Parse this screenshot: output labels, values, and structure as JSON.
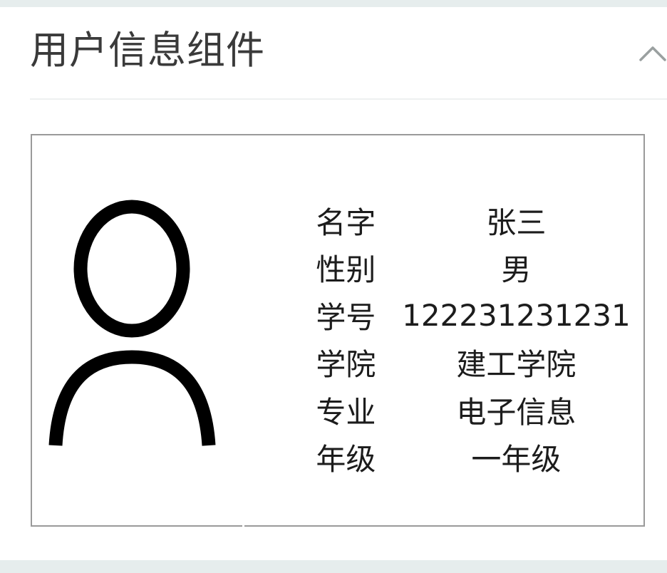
{
  "header": {
    "title": "用户信息组件",
    "collapse_icon": "chevron-up-icon"
  },
  "card": {
    "avatar_icon": "user-avatar-icon",
    "rows": [
      {
        "label": "名字",
        "value": "张三"
      },
      {
        "label": "性别",
        "value": "男"
      },
      {
        "label": "学号",
        "value": "122231231231"
      },
      {
        "label": "学院",
        "value": "建工学院"
      },
      {
        "label": "专业",
        "value": "电子信息"
      },
      {
        "label": "年级",
        "value": "一年级"
      }
    ]
  },
  "colors": {
    "page_background": "#e6eded",
    "panel_background": "#ffffff",
    "card_border": "#9a9a9a",
    "title_text": "#3a3a3a",
    "body_text": "#1c1c1c"
  }
}
